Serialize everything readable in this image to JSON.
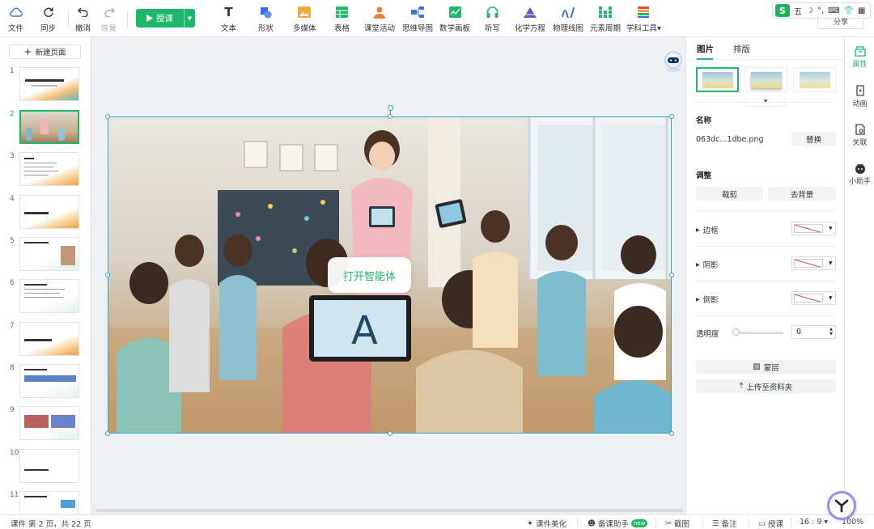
{
  "toolbar": {
    "file": "文件",
    "sync": "同步",
    "undo": "撤消",
    "redo": "恢复",
    "start_class": "授课",
    "items": [
      "文本",
      "形状",
      "多媒体",
      "表格",
      "课堂活动",
      "思维导图",
      "数学画板",
      "听写",
      "化学方程",
      "物理线图",
      "元素周期",
      "学科工具"
    ]
  },
  "ime": {
    "brand": "S",
    "mode": "五"
  },
  "share": "分享",
  "left_panel": {
    "new_page": "新建页面",
    "slides": [
      "1",
      "2",
      "3",
      "4",
      "5",
      "6",
      "7",
      "8",
      "9",
      "10",
      "11"
    ],
    "active_slide": 2
  },
  "canvas": {
    "ai_button": "打开智能体"
  },
  "props": {
    "tab_picture": "图片",
    "tab_layout": "排版",
    "name_title": "名称",
    "file_name": "063dc...1dbe.png",
    "replace": "替换",
    "adjust_title": "调整",
    "crop": "裁剪",
    "remove_bg": "去背景",
    "border": "边框",
    "shadow": "阴影",
    "reflection": "倒影",
    "opacity_label": "透明度",
    "opacity_value": "0",
    "mask": "蒙层",
    "upload": "上传至资料夹"
  },
  "right_rail": [
    "属性",
    "动画",
    "关联",
    "小助手"
  ],
  "status": {
    "page_info": "课件 第 2 页，共 22 页",
    "beautify": "课件美化",
    "assistant": "备课助手",
    "new_badge": "new",
    "screenshot": "截图",
    "notes": "备注",
    "teach": "授课",
    "ratio": "16 : 9",
    "zoom": "100%"
  },
  "colors": {
    "accent": "#1fb86a",
    "selection": "#39a3c9"
  }
}
